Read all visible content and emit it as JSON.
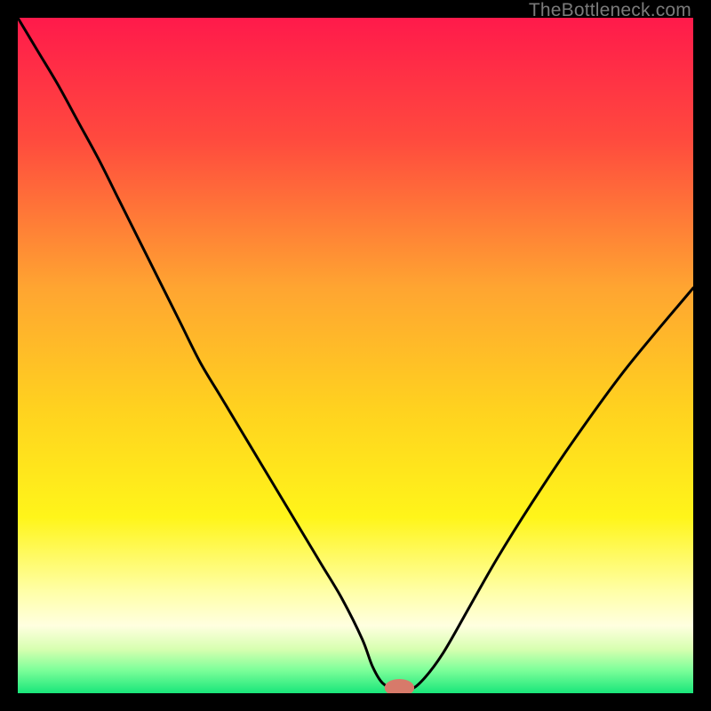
{
  "watermark": "TheBottleneck.com",
  "chart_data": {
    "type": "line",
    "title": "",
    "xlabel": "",
    "ylabel": "",
    "xlim": [
      0,
      100
    ],
    "ylim": [
      0,
      100
    ],
    "gradient_stops": [
      {
        "offset": 0.0,
        "color": "#ff1a4b"
      },
      {
        "offset": 0.18,
        "color": "#ff4a3e"
      },
      {
        "offset": 0.4,
        "color": "#ffa531"
      },
      {
        "offset": 0.58,
        "color": "#ffd21f"
      },
      {
        "offset": 0.74,
        "color": "#fff51a"
      },
      {
        "offset": 0.85,
        "color": "#ffffa8"
      },
      {
        "offset": 0.9,
        "color": "#ffffe0"
      },
      {
        "offset": 0.935,
        "color": "#d7ffb0"
      },
      {
        "offset": 0.965,
        "color": "#7fff9a"
      },
      {
        "offset": 1.0,
        "color": "#19e67a"
      }
    ],
    "series": [
      {
        "name": "bottleneck-curve",
        "x": [
          0.0,
          3.0,
          6.0,
          9.0,
          12.0,
          15.0,
          18.0,
          21.0,
          24.0,
          27.0,
          30.0,
          33.0,
          36.0,
          39.0,
          42.0,
          45.0,
          48.0,
          51.0,
          52.5,
          54.0,
          56.0,
          58.0,
          60.0,
          63.0,
          67.0,
          71.0,
          76.0,
          82.0,
          90.0,
          100.0
        ],
        "y": [
          100.0,
          95.0,
          90.0,
          84.5,
          79.0,
          73.0,
          67.0,
          61.0,
          55.0,
          49.0,
          44.0,
          39.0,
          34.0,
          29.0,
          24.0,
          19.0,
          14.0,
          8.0,
          4.0,
          1.5,
          0.5,
          0.5,
          2.0,
          6.0,
          13.0,
          20.0,
          28.0,
          37.0,
          48.0,
          60.0
        ]
      }
    ],
    "marker": {
      "x": 56.5,
      "y": 0.8,
      "rx": 2.2,
      "ry": 1.3,
      "color": "#d77a6a"
    }
  }
}
